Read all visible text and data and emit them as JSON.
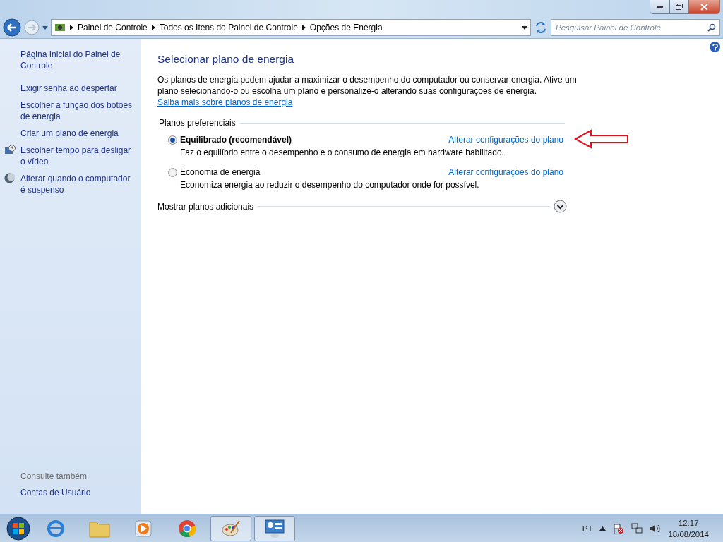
{
  "address_bar": {
    "breadcrumbs": [
      "Painel de Controle",
      "Todos os Itens do Painel de Controle",
      "Opções de Energia"
    ]
  },
  "search": {
    "placeholder": "Pesquisar Painel de Controle"
  },
  "sidebar": {
    "items": [
      {
        "label": "Página Inicial do Painel de Controle",
        "kind": "plain"
      },
      {
        "label": "Exigir senha ao despertar",
        "kind": "plain"
      },
      {
        "label": "Escolher a função dos botões de energia",
        "kind": "plain"
      },
      {
        "label": "Criar um plano de energia",
        "kind": "plain"
      },
      {
        "label": "Escolher tempo para desligar o vídeo",
        "kind": "display"
      },
      {
        "label": "Alterar quando o computador é suspenso",
        "kind": "sleep"
      }
    ],
    "see_also": {
      "heading": "Consulte também",
      "items": [
        "Contas de Usuário"
      ]
    }
  },
  "main": {
    "title": "Selecionar plano de energia",
    "description": "Os planos de energia podem ajudar a maximizar o desempenho do computador ou conservar energia. Ative um plano selecionando-o ou escolha um plano e personalize-o alterando suas configurações de energia.",
    "learn_more": "Saiba mais sobre planos de energia",
    "group_label": "Planos preferenciais",
    "plans": [
      {
        "name": "Equilibrado (recomendável)",
        "description": "Faz o equilíbrio entre o desempenho e o consumo de energia em hardware habilitado.",
        "link": "Alterar configurações do plano",
        "selected": true,
        "annotated": true
      },
      {
        "name": "Economia de energia",
        "description": "Economiza energia ao reduzir o desempenho do computador onde for possível.",
        "link": "Alterar configurações do plano",
        "selected": false,
        "annotated": false
      }
    ],
    "show_more": "Mostrar planos adicionais"
  },
  "taskbar": {
    "apps": [
      {
        "kind": "browser",
        "open": false
      },
      {
        "kind": "folder",
        "open": false
      },
      {
        "kind": "media",
        "open": false
      },
      {
        "kind": "chrome",
        "open": false
      },
      {
        "kind": "paint",
        "open": true
      },
      {
        "kind": "control",
        "open": true
      }
    ],
    "language": "PT",
    "time": "12:17",
    "date": "18/08/2014"
  }
}
